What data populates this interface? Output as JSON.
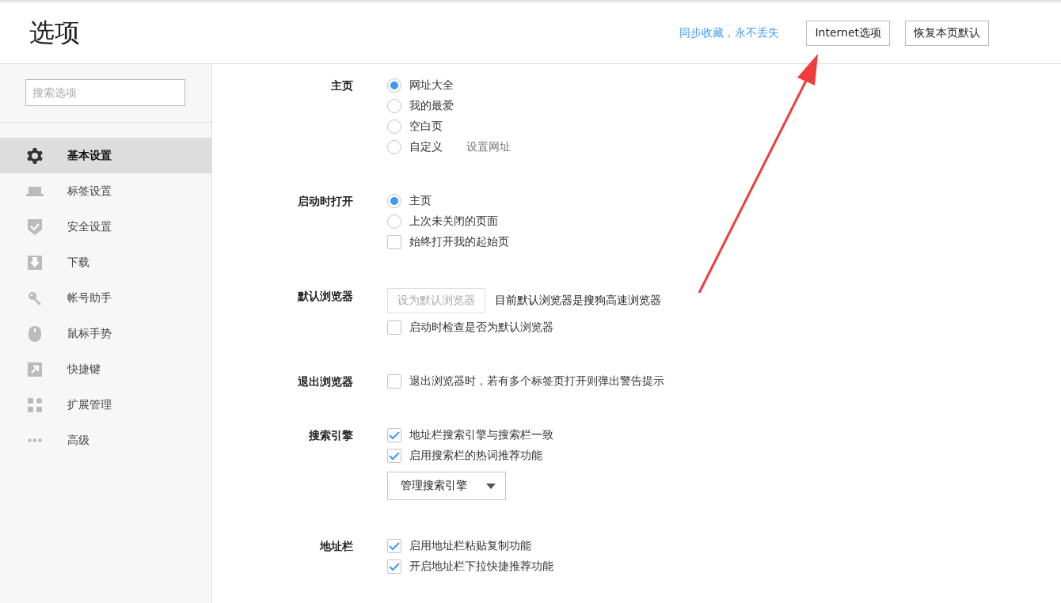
{
  "header": {
    "title": "选项",
    "sync_link": "同步收藏，永不丢失",
    "buttons": [
      "Internet选项",
      "恢复本页默认"
    ]
  },
  "sidebar": {
    "search": {
      "placeholder": "搜索选项"
    },
    "items": [
      {
        "label": "基本设置",
        "selected": true
      },
      {
        "label": "标签设置",
        "selected": false
      },
      {
        "label": "安全设置",
        "selected": false
      },
      {
        "label": "下载",
        "selected": false
      },
      {
        "label": "帐号助手",
        "selected": false
      },
      {
        "label": "鼠标手势",
        "selected": false
      },
      {
        "label": "快捷键",
        "selected": false
      },
      {
        "label": "扩展管理",
        "selected": false
      },
      {
        "label": "高级",
        "selected": false
      }
    ]
  },
  "sections": [
    {
      "label": "主页",
      "rows": [
        {
          "kind": "radio",
          "label": "网址大全",
          "selected": true
        },
        {
          "kind": "radio",
          "label": "我的最爱",
          "selected": false
        },
        {
          "kind": "radio",
          "label": "空白页",
          "selected": false
        },
        {
          "kind": "radio",
          "label": "自定义",
          "selected": false,
          "link": "设置网址"
        }
      ]
    },
    {
      "label": "启动时打开",
      "rows": [
        {
          "kind": "radio",
          "label": "主页",
          "selected": true
        },
        {
          "kind": "radio",
          "label": "上次未关闭的页面",
          "selected": false
        },
        {
          "kind": "checkbox",
          "label": "始终打开我的起始页",
          "checked": false
        }
      ]
    },
    {
      "label": "默认浏览器",
      "rows": [
        {
          "kind": "button",
          "label": "设为默认浏览器",
          "disabled": true,
          "note": "目前默认浏览器是搜狗高速浏览器"
        },
        {
          "kind": "checkbox",
          "label": "启动时检查是否为默认浏览器",
          "checked": false
        }
      ]
    },
    {
      "label": "退出浏览器",
      "rows": [
        {
          "kind": "checkbox",
          "label": "退出浏览器时，若有多个标签页打开则弹出警告提示",
          "checked": false
        }
      ]
    },
    {
      "label": "搜索引擎",
      "rows": [
        {
          "kind": "checkbox",
          "label": "地址栏搜索引擎与搜索栏一致",
          "checked": true
        },
        {
          "kind": "checkbox",
          "label": "启用搜索栏的热词推荐功能",
          "checked": true
        },
        {
          "kind": "dropdown",
          "label": "管理搜索引擎"
        }
      ]
    },
    {
      "label": "地址栏",
      "rows": [
        {
          "kind": "checkbox",
          "label": "启用地址栏粘贴复制功能",
          "checked": true
        },
        {
          "kind": "checkbox",
          "label": "开启地址栏下拉快捷推荐功能",
          "checked": true
        }
      ]
    }
  ]
}
